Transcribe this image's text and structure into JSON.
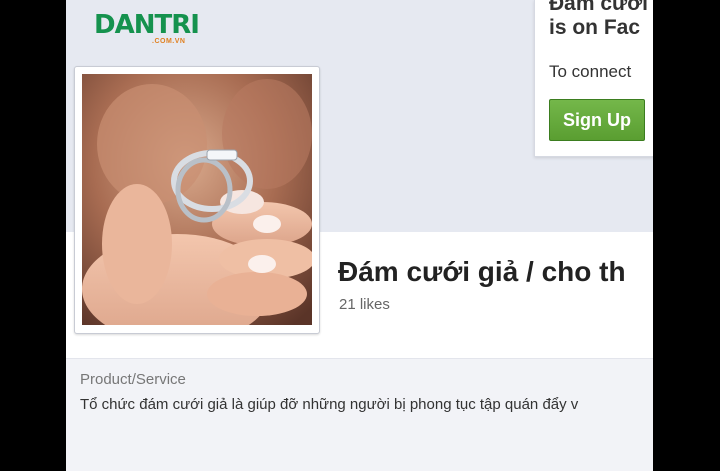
{
  "brand": {
    "logo_text": "DANTRI",
    "logo_sub": ".COM.VN"
  },
  "signup": {
    "line1": "Đám cưới",
    "line2": "is on Fac",
    "connect": "To connect",
    "button": "Sign Up"
  },
  "page": {
    "title": "Đám cưới giả / cho th",
    "likes": "21 likes",
    "category": "Product/Service",
    "description": "Tổ chức đám cưới giả là giúp đỡ những người bị phong tục tập quán đẩy v"
  },
  "colors": {
    "brand_green": "#15924e",
    "signup_green": "#5a9e31",
    "cover_bg": "#e6e9f1"
  }
}
